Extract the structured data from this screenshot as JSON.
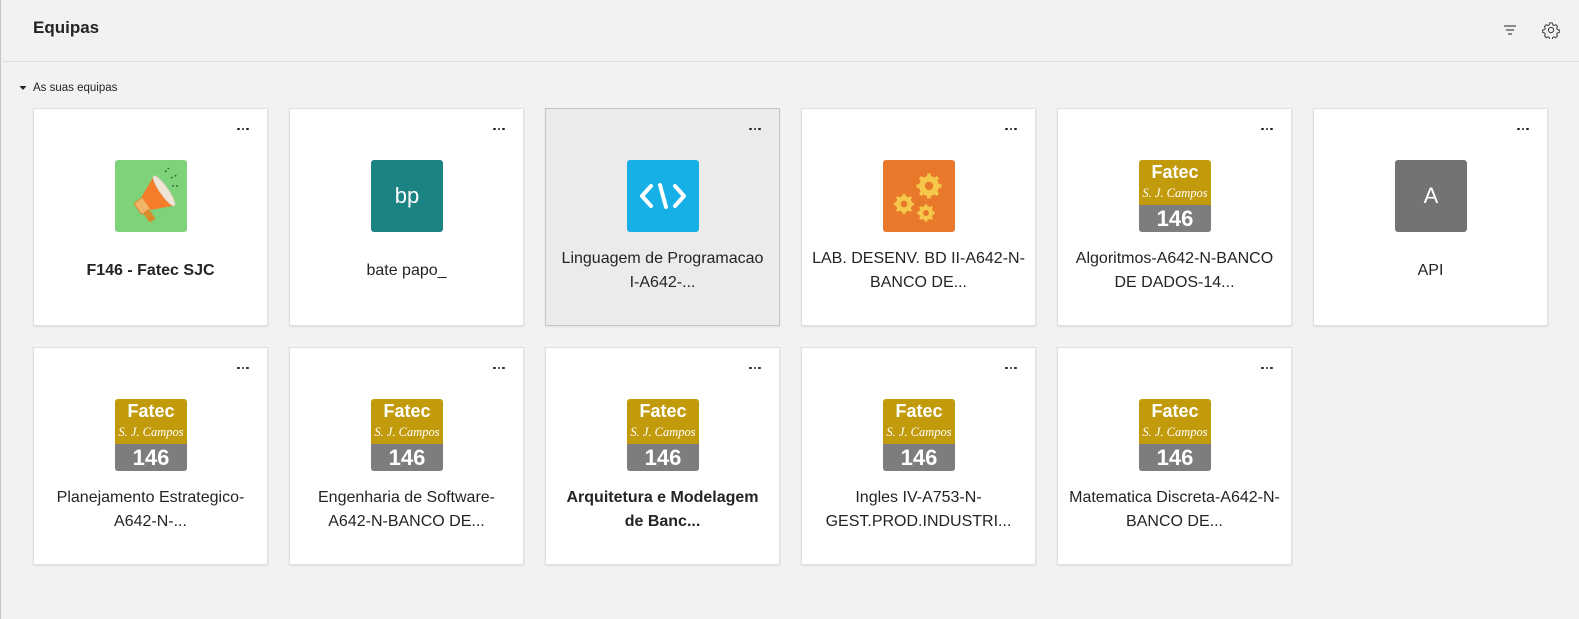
{
  "header": {
    "title": "Equipas"
  },
  "icons": {
    "filter": "filter-icon",
    "settings": "gear-icon",
    "more": "more-options-icon",
    "caret": "caret-down-icon"
  },
  "section": {
    "label": "As suas equipas"
  },
  "logo_text": {
    "top": "Fatec",
    "middle": "S. J. Campos",
    "bottom": "146"
  },
  "colors": {
    "megaphone_bg": "#7ed37a",
    "bp_bg": "#1b8382",
    "code_bg": "#17b0e6",
    "gears_bg": "#e9792a",
    "api_bg": "#737373",
    "fatec_gold": "#c29b0c",
    "fatec_gray": "#7d7d7d"
  },
  "teams": [
    {
      "name": "F146 - Fatec SJC",
      "bold": true,
      "avatar": "megaphone"
    },
    {
      "name": "bate papo_",
      "bold": false,
      "avatar": "initials",
      "initials": "bp"
    },
    {
      "name": "Linguagem de Programacao I-A642-...",
      "bold": false,
      "avatar": "code",
      "selected": true
    },
    {
      "name": "LAB. DESENV. BD II-A642-N-BANCO DE...",
      "bold": false,
      "avatar": "gears"
    },
    {
      "name": "Algoritmos-A642-N-BANCO DE DADOS-14...",
      "bold": false,
      "avatar": "fatec"
    },
    {
      "name": "API",
      "bold": false,
      "avatar": "initials",
      "initials": "A"
    },
    {
      "name": "Planejamento Estrategico-A642-N-...",
      "bold": false,
      "avatar": "fatec"
    },
    {
      "name": "Engenharia de Software-A642-N-BANCO DE...",
      "bold": false,
      "avatar": "fatec"
    },
    {
      "name": "Arquitetura e Modelagem de Banc...",
      "bold": true,
      "avatar": "fatec"
    },
    {
      "name": "Ingles IV-A753-N-GEST.PROD.INDUSTRI...",
      "bold": false,
      "avatar": "fatec"
    },
    {
      "name": "Matematica Discreta-A642-N-BANCO DE...",
      "bold": false,
      "avatar": "fatec"
    }
  ]
}
